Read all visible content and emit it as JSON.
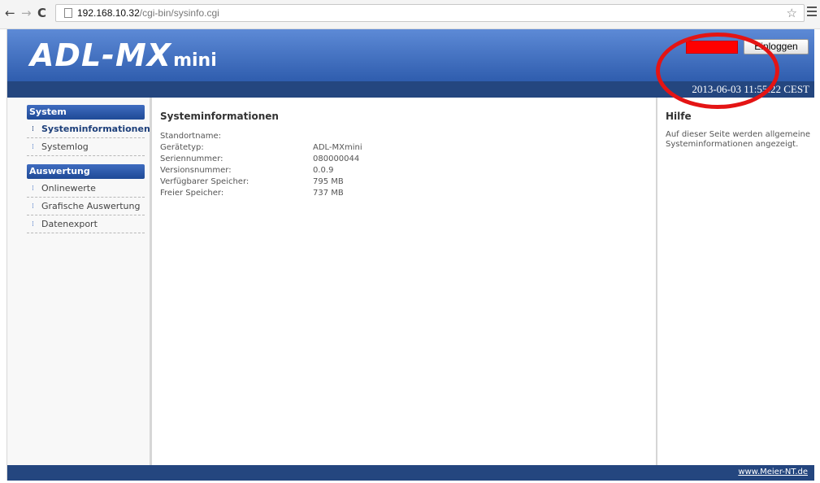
{
  "browser": {
    "nav": {
      "back": "←",
      "forward": "→",
      "reload": "C"
    },
    "url_host": "192.168.10.32",
    "url_path": "/cgi-bin/sysinfo.cgi",
    "star": "☆"
  },
  "header": {
    "logo_main": "ADL-MX",
    "logo_sub": "mini",
    "login_button": "Einloggen",
    "login_field_color": "#ff0000",
    "datetime": "2013-06-03 11:55:22 CEST",
    "brand_color": "#2f5dae"
  },
  "sidebar": {
    "sections": [
      {
        "title": "System",
        "items": [
          {
            "label": "Systeminformationen",
            "active": true
          },
          {
            "label": "Systemlog",
            "active": false
          }
        ]
      },
      {
        "title": "Auswertung",
        "items": [
          {
            "label": "Onlinewerte",
            "active": false
          },
          {
            "label": "Grafische Auswertung",
            "active": false
          },
          {
            "label": "Datenexport",
            "active": false
          }
        ]
      }
    ],
    "bullet": "⁞"
  },
  "main": {
    "title": "Systeminformationen",
    "rows": [
      {
        "label": "Standortname:",
        "value": ""
      },
      {
        "label": "Gerätetyp:",
        "value": "ADL-MXmini"
      },
      {
        "label": "Seriennummer:",
        "value": "080000044"
      },
      {
        "label": "Versionsnummer:",
        "value": "0.0.9"
      },
      {
        "label": "Verfügbarer Speicher:",
        "value": "795 MB"
      },
      {
        "label": "Freier Speicher:",
        "value": "737 MB"
      }
    ]
  },
  "help": {
    "title": "Hilfe",
    "text": "Auf dieser Seite werden allgemeine Systeminformationen angezeigt."
  },
  "footer": {
    "link": "www.Meier-NT.de"
  },
  "annotation": {
    "color": "#e41414",
    "shape": "circle-around-login"
  }
}
